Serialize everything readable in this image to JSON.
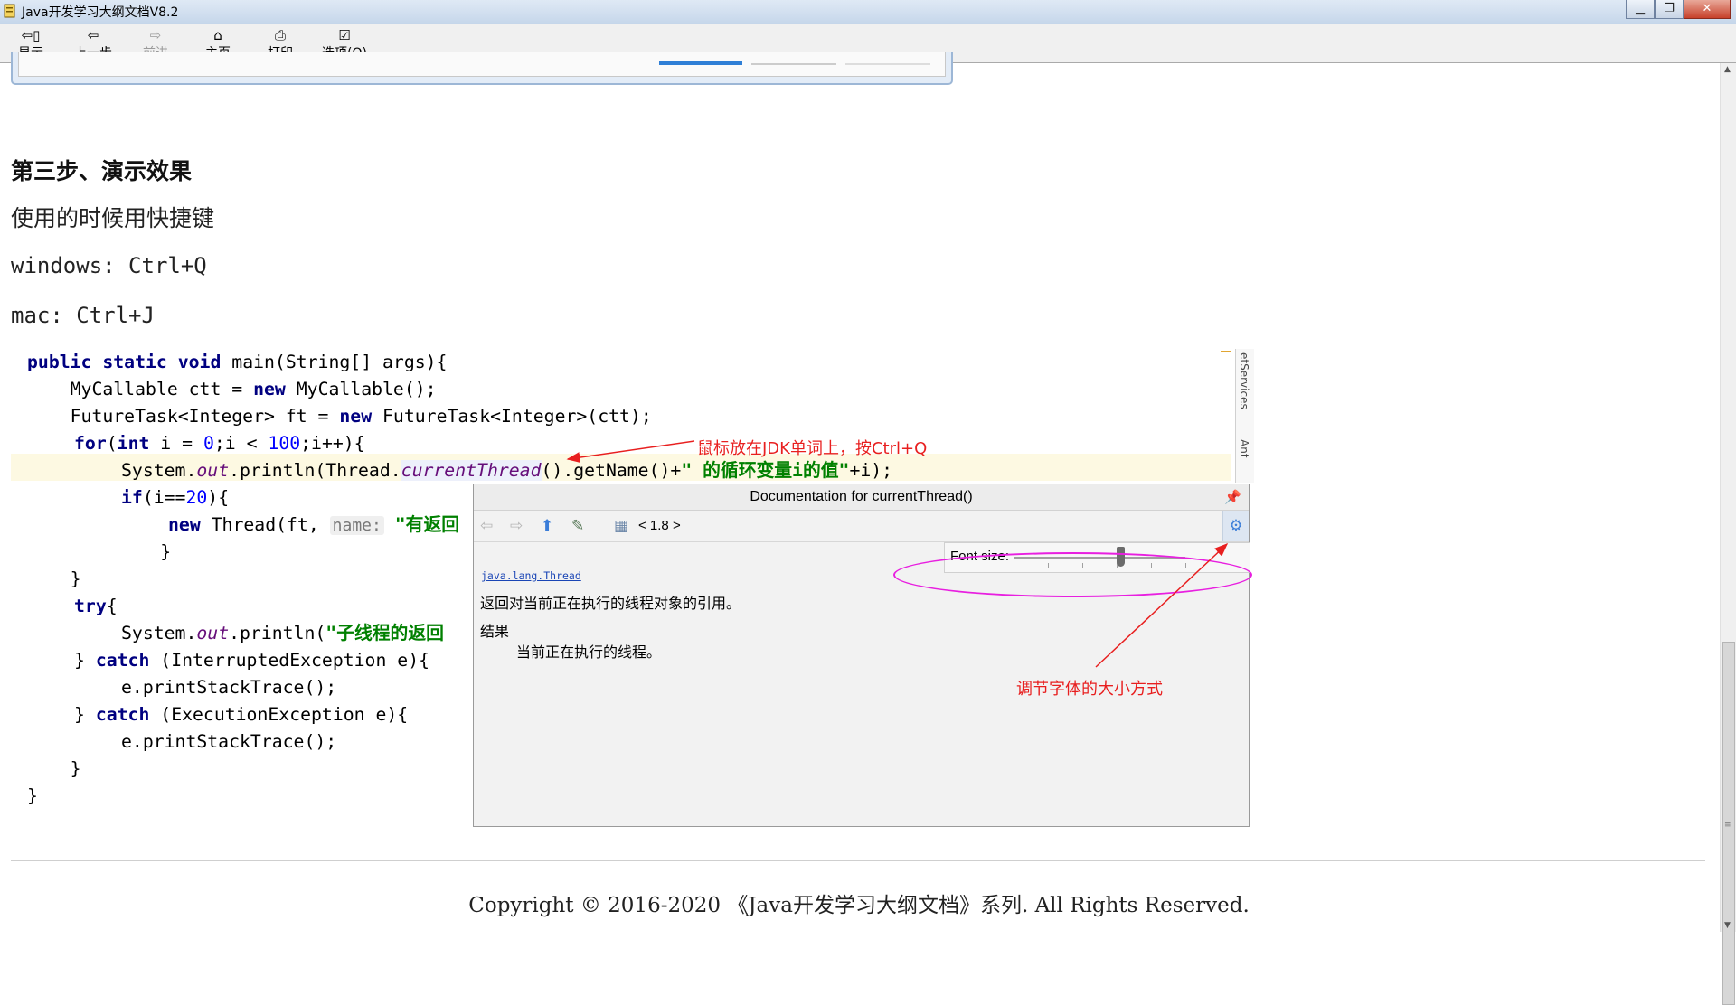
{
  "window": {
    "title": "Java开发学习大纲文档V8.2",
    "controls": [
      "▁",
      "❐",
      "✕"
    ]
  },
  "toolbar": {
    "buttons": [
      {
        "label": "显示",
        "icon": "show-icon",
        "enabled": true
      },
      {
        "label": "上一步",
        "icon": "back-arrow-icon",
        "enabled": true
      },
      {
        "label": "前进",
        "icon": "forward-arrow-icon",
        "enabled": false
      },
      {
        "label": "主页",
        "icon": "home-icon",
        "enabled": true
      },
      {
        "label": "打印",
        "icon": "printer-icon",
        "enabled": true
      },
      {
        "label": "选项(O)",
        "icon": "options-icon",
        "enabled": true
      }
    ]
  },
  "article": {
    "heading": "第三步、演示效果",
    "line1": "使用的时候用快捷键",
    "line2": "windows: Ctrl+Q",
    "line3": "mac: Ctrl+J"
  },
  "code": {
    "l1_kw": "public static void",
    "l1_rest": " main(String[] args){",
    "l2_a": "    MyCallable ctt = ",
    "l2_kw": "new",
    "l2_b": " MyCallable();",
    "l3_a": "    FutureTask<Integer> ft = ",
    "l3_kw": "new",
    "l3_b": " FutureTask<Integer>(ctt);",
    "l4_kw1": "for",
    "l4_a": "(",
    "l4_kw2": "int",
    "l4_b": " i = ",
    "l4_n1": "0",
    "l4_c": ";i < ",
    "l4_n2": "100",
    "l4_d": ";i++){",
    "l5_a": "System.",
    "l5_it": "out",
    "l5_b": ".println(Thread.",
    "l5_hover": "currentThread",
    "l5_c": "().getName()+",
    "l5_str": "\" 的循环变量i的值\"",
    "l5_d": "+i);",
    "l6_kw": "if",
    "l6_a": "(i==",
    "l6_n": "20",
    "l6_b": "){",
    "l7_kw": "new",
    "l7_a": " Thread(ft, ",
    "l7_hint": "name:",
    "l7_str": " \"有返回",
    "l8": "        }",
    "l9": "    }",
    "l10_kw": "try",
    "l10_a": "{",
    "l11_a": "System.",
    "l11_it": "out",
    "l11_b": ".println(",
    "l11_str": "\"子线程的返回",
    "l12_a": "} ",
    "l12_kw": "catch",
    "l12_b": " (InterruptedException e){",
    "l13": "e.printStackTrace();",
    "l14_a": "} ",
    "l14_kw": "catch",
    "l14_b": " (ExecutionException e){",
    "l15": "e.printStackTrace();",
    "l16": "    }",
    "l17": "}",
    "side_tab1": "etServices",
    "side_tab2": "Ant"
  },
  "doc_popup": {
    "title": "Documentation for currentThread()",
    "version": "< 1.8 >",
    "font_size_label": "Font size:",
    "font_size_level": 0.62,
    "link": "java.lang.Thread",
    "description": "返回对当前正在执行的线程对象的引用。",
    "section": "结果",
    "returns": "当前正在执行的线程。"
  },
  "annotations": {
    "hover_note": "鼠标放在JDK单词上，按Ctrl+Q",
    "font_note": "调节字体的大小方式"
  },
  "colors": {
    "annotation_red": "#e81f1f",
    "ellipse_magenta": "#e81fe0",
    "keyword": "#000080",
    "string": "#008000"
  },
  "footer": {
    "text": "Copyright © 2016-2020 《Java开发学习大纲文档》系列. All Rights Reserved."
  }
}
